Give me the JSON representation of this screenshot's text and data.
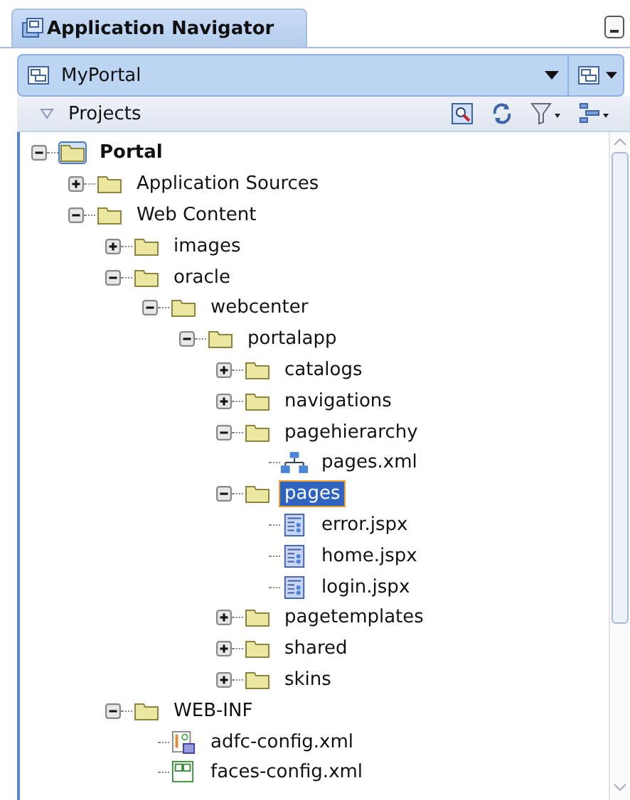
{
  "panel_tab": {
    "title": "Application Navigator",
    "selected": true
  },
  "application_selector": {
    "value": "MyPortal"
  },
  "section": {
    "title": "Projects",
    "expanded": true
  },
  "tree": [
    {
      "name": "Portal",
      "kind": "project",
      "expanded": true,
      "selected": false,
      "children": [
        {
          "name": "Application Sources",
          "kind": "folder",
          "expanded": false,
          "selected": false
        },
        {
          "name": "Web Content",
          "kind": "folder",
          "expanded": true,
          "selected": false,
          "children": [
            {
              "name": "images",
              "kind": "folder",
              "expanded": false,
              "selected": false
            },
            {
              "name": "oracle",
              "kind": "folder",
              "expanded": true,
              "selected": false,
              "children": [
                {
                  "name": "webcenter",
                  "kind": "folder",
                  "expanded": true,
                  "selected": false,
                  "children": [
                    {
                      "name": "portalapp",
                      "kind": "folder",
                      "expanded": true,
                      "selected": false,
                      "children": [
                        {
                          "name": "catalogs",
                          "kind": "folder",
                          "expanded": false,
                          "selected": false
                        },
                        {
                          "name": "navigations",
                          "kind": "folder",
                          "expanded": false,
                          "selected": false
                        },
                        {
                          "name": "pagehierarchy",
                          "kind": "folder",
                          "expanded": true,
                          "selected": false,
                          "children": [
                            {
                              "name": "pages.xml",
                              "kind": "hierarchy",
                              "selected": false
                            }
                          ]
                        },
                        {
                          "name": "pages",
                          "kind": "folder",
                          "expanded": true,
                          "selected": true,
                          "children": [
                            {
                              "name": "error.jspx",
                              "kind": "page",
                              "selected": false
                            },
                            {
                              "name": "home.jspx",
                              "kind": "page",
                              "selected": false
                            },
                            {
                              "name": "login.jspx",
                              "kind": "page",
                              "selected": false
                            }
                          ]
                        },
                        {
                          "name": "pagetemplates",
                          "kind": "folder",
                          "expanded": false,
                          "selected": false
                        },
                        {
                          "name": "shared",
                          "kind": "folder",
                          "expanded": false,
                          "selected": false
                        },
                        {
                          "name": "skins",
                          "kind": "folder",
                          "expanded": false,
                          "selected": false
                        }
                      ]
                    }
                  ]
                }
              ]
            },
            {
              "name": "WEB-INF",
              "kind": "folder",
              "expanded": true,
              "selected": false,
              "children": [
                {
                  "name": "adfc-config.xml",
                  "kind": "taskflow",
                  "selected": false
                },
                {
                  "name": "faces-config.xml",
                  "kind": "faces",
                  "selected": false
                }
              ]
            }
          ]
        }
      ]
    }
  ]
}
